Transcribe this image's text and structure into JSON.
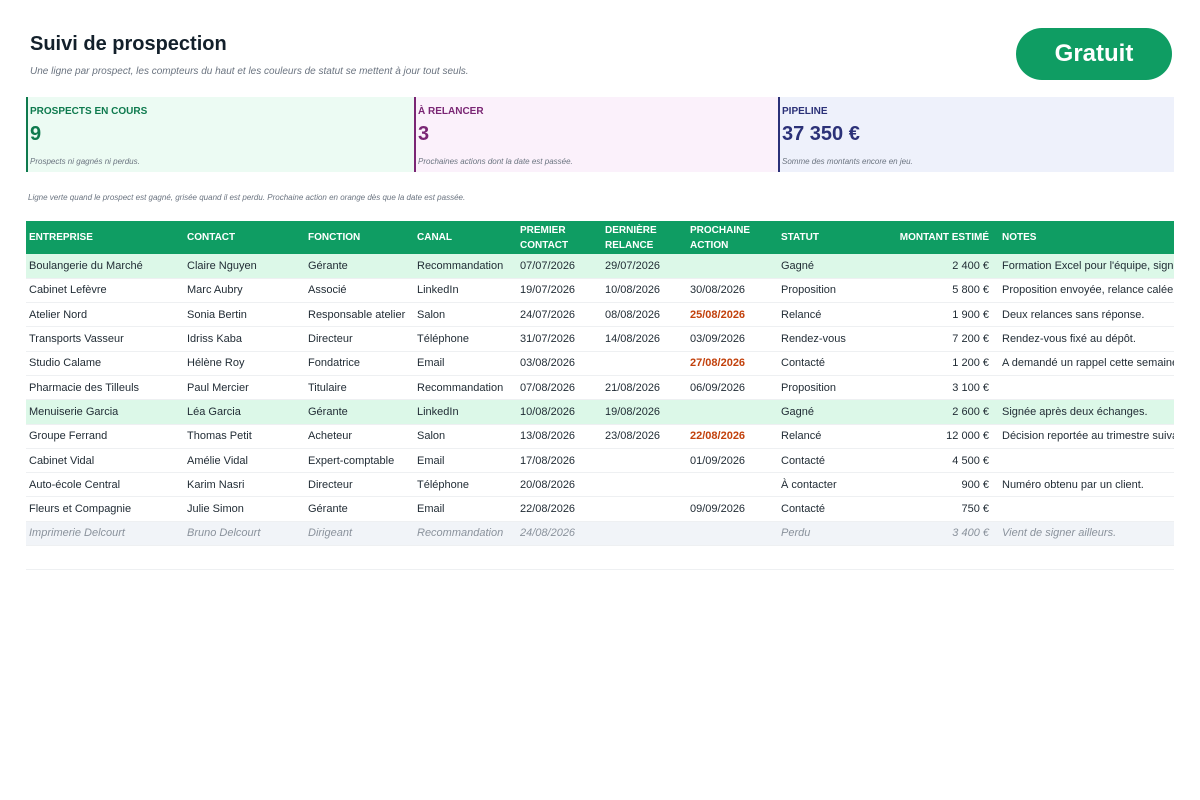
{
  "header": {
    "title": "Suivi de prospection",
    "subtitle": "Une ligne par prospect, les compteurs du haut et les couleurs de statut se mettent à jour tout seuls.",
    "badge": "Gratuit"
  },
  "kpis": [
    {
      "label": "PROSPECTS EN COURS",
      "value": "9",
      "note": "Prospects ni gagnés ni perdus.",
      "color": "#0e7a4e"
    },
    {
      "label": "À RELANCER",
      "value": "3",
      "note": "Prochaines actions dont la date est passée.",
      "color": "#7a2674"
    },
    {
      "label": "PIPELINE",
      "value": "37 350 €",
      "note": "Somme des montants encore en jeu.",
      "color": "#2b3178"
    }
  ],
  "legend": "Ligne verte quand le prospect est gagné, grisée quand il est perdu. Prochaine action en orange dès que la date est passée.",
  "table": {
    "columns": [
      "ENTREPRISE",
      "CONTACT",
      "FONCTION",
      "CANAL",
      "PREMIER CONTACT",
      "DERNIÈRE RELANCE",
      "PROCHAINE ACTION",
      "STATUT",
      "MONTANT ESTIMÉ",
      "NOTES"
    ],
    "rows": [
      {
        "state": "won",
        "overdue": false,
        "cells": [
          "Boulangerie du Marché",
          "Claire Nguyen",
          "Gérante",
          "Recommandation",
          "07/07/2026",
          "29/07/2026",
          "",
          "Gagné",
          "2 400 €",
          "Formation Excel pour l'équipe, signé"
        ]
      },
      {
        "state": "",
        "overdue": false,
        "cells": [
          "Cabinet Lefèvre",
          "Marc Aubry",
          "Associé",
          "LinkedIn",
          "19/07/2026",
          "10/08/2026",
          "30/08/2026",
          "Proposition",
          "5 800 €",
          "Proposition envoyée, relance calée"
        ]
      },
      {
        "state": "",
        "overdue": true,
        "cells": [
          "Atelier Nord",
          "Sonia Bertin",
          "Responsable atelier",
          "Salon",
          "24/07/2026",
          "08/08/2026",
          "25/08/2026",
          "Relancé",
          "1 900 €",
          "Deux relances sans réponse."
        ]
      },
      {
        "state": "",
        "overdue": false,
        "cells": [
          "Transports Vasseur",
          "Idriss Kaba",
          "Directeur",
          "Téléphone",
          "31/07/2026",
          "14/08/2026",
          "03/09/2026",
          "Rendez-vous",
          "7 200 €",
          "Rendez-vous fixé au dépôt."
        ]
      },
      {
        "state": "",
        "overdue": true,
        "cells": [
          "Studio Calame",
          "Hélène Roy",
          "Fondatrice",
          "Email",
          "03/08/2026",
          "",
          "27/08/2026",
          "Contacté",
          "1 200 €",
          "A demandé un rappel cette semaine"
        ]
      },
      {
        "state": "",
        "overdue": false,
        "cells": [
          "Pharmacie des Tilleuls",
          "Paul Mercier",
          "Titulaire",
          "Recommandation",
          "07/08/2026",
          "21/08/2026",
          "06/09/2026",
          "Proposition",
          "3 100 €",
          ""
        ]
      },
      {
        "state": "won",
        "overdue": false,
        "cells": [
          "Menuiserie Garcia",
          "Léa Garcia",
          "Gérante",
          "LinkedIn",
          "10/08/2026",
          "19/08/2026",
          "",
          "Gagné",
          "2 600 €",
          "Signée après deux échanges."
        ]
      },
      {
        "state": "",
        "overdue": true,
        "cells": [
          "Groupe Ferrand",
          "Thomas Petit",
          "Acheteur",
          "Salon",
          "13/08/2026",
          "23/08/2026",
          "22/08/2026",
          "Relancé",
          "12 000 €",
          "Décision reportée au trimestre suivant"
        ]
      },
      {
        "state": "",
        "overdue": false,
        "cells": [
          "Cabinet Vidal",
          "Amélie Vidal",
          "Expert-comptable",
          "Email",
          "17/08/2026",
          "",
          "01/09/2026",
          "Contacté",
          "4 500 €",
          ""
        ]
      },
      {
        "state": "",
        "overdue": false,
        "cells": [
          "Auto-école Central",
          "Karim Nasri",
          "Directeur",
          "Téléphone",
          "20/08/2026",
          "",
          "",
          "À contacter",
          "900 €",
          "Numéro obtenu par un client."
        ]
      },
      {
        "state": "",
        "overdue": false,
        "cells": [
          "Fleurs et Compagnie",
          "Julie Simon",
          "Gérante",
          "Email",
          "22/08/2026",
          "",
          "09/09/2026",
          "Contacté",
          "750 €",
          ""
        ]
      },
      {
        "state": "lost",
        "overdue": false,
        "cells": [
          "Imprimerie Delcourt",
          "Bruno Delcourt",
          "Dirigeant",
          "Recommandation",
          "24/08/2026",
          "",
          "",
          "Perdu",
          "3 400 €",
          "Vient de signer ailleurs."
        ]
      }
    ]
  }
}
